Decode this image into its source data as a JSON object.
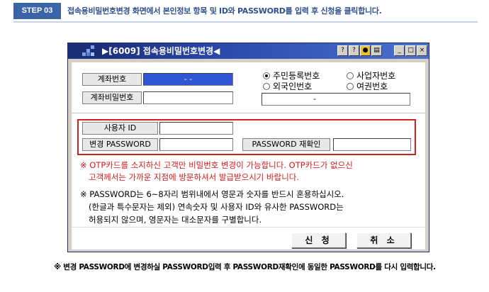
{
  "step": {
    "badge": "STEP 03",
    "instruction": "접속용비밀번호변경 화면에서 본인정보 항목 및 ID와 PASSWORD를 입력 후 신청을 클릭합니다."
  },
  "window": {
    "title": "▶[6009] 접속용비밀번호변경◀",
    "controls": {
      "minimize": "_",
      "maximize": "□",
      "close": "×"
    }
  },
  "form": {
    "account_label": "계좌번호",
    "account_value": "-   -",
    "account_pw_label": "계좌비밀번호",
    "radio_options": [
      "주민등록번호",
      "사업자번호",
      "외국인번호",
      "여권번호"
    ],
    "id_number_value": "-",
    "user_id_label": "사용자 ID",
    "change_pw_label": "변경 PASSWORD",
    "confirm_pw_label": "PASSWORD 재확인"
  },
  "warning": {
    "line1": "※ OTP카드를 소지하신 고객만 비밀번호 변경이 가능합니다. OTP카드가 없으신",
    "line2": "고객께서는 가까운 지점에 방문하셔서 발급받으시기 바랍니다."
  },
  "note": {
    "line1": "※ PASSWORD는  6~8자리 범위내에서 영문과 숫자를 반드시 혼용하십시오.",
    "line2": "(한글과 특수문자는 제외) 연속숫자 및 사용자 ID와 유사한 PASSWORD는",
    "line3": "허용되지 않으며, 영문자는 대소문자를 구별합니다."
  },
  "buttons": {
    "apply": "신 청",
    "cancel": "취 소"
  },
  "footnote": "※ 변경 PASSWORD에 변경하실 PASSWORD입력 후 PASSWORD재확인에 동일한 PASSWORD를 다시 입력합니다."
}
